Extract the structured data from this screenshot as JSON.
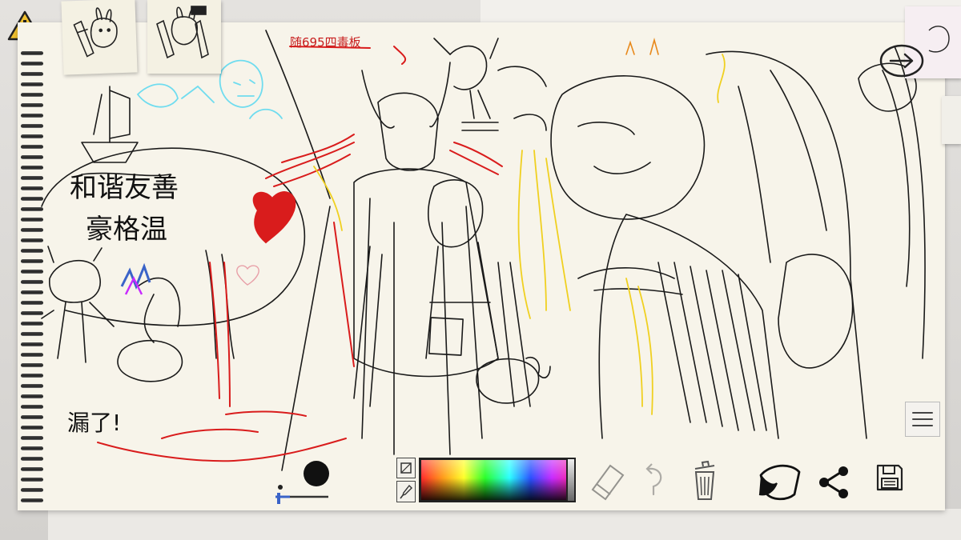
{
  "drawing": {
    "text_greeting_line1": "和谐友善",
    "text_greeting_line2": "豪格温",
    "text_top_note": "随695四毒板",
    "text_bottom_note": "漏了!"
  },
  "toolbar": {
    "brush_size_label": "brush-size",
    "tools": [
      "palette-toggle",
      "eyedropper",
      "color-picker",
      "eraser",
      "undo",
      "trash",
      "bucket",
      "share",
      "save"
    ]
  },
  "hud": {
    "next_label": "next",
    "menu_label": "menu",
    "warning_label": "warning"
  },
  "colors": {
    "paper": "#f7f4ea",
    "ink": "#1a1a1a",
    "red": "#d91c1c",
    "yellow": "#f0d020",
    "cyan": "#6fdcef",
    "accent_blue": "#3a63c8"
  },
  "brush": {
    "size_fraction": 0.55
  }
}
